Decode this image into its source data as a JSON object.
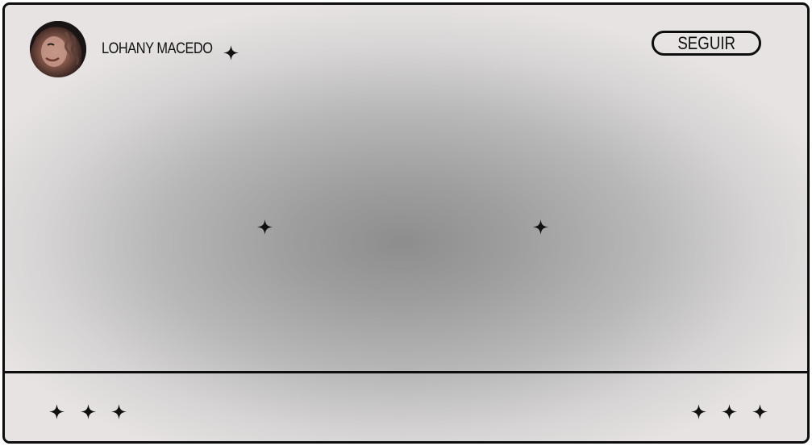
{
  "profile": {
    "name": "LOHANY MACEDO",
    "avatar_icon": "profile-photo"
  },
  "header": {
    "follow_label": "SEGUIR"
  },
  "icons": {
    "sparkle": "sparkle-icon"
  },
  "colors": {
    "border": "#0d0d0d",
    "gradient_center": "#8d8d8d",
    "gradient_edge": "#e6e3e2"
  }
}
